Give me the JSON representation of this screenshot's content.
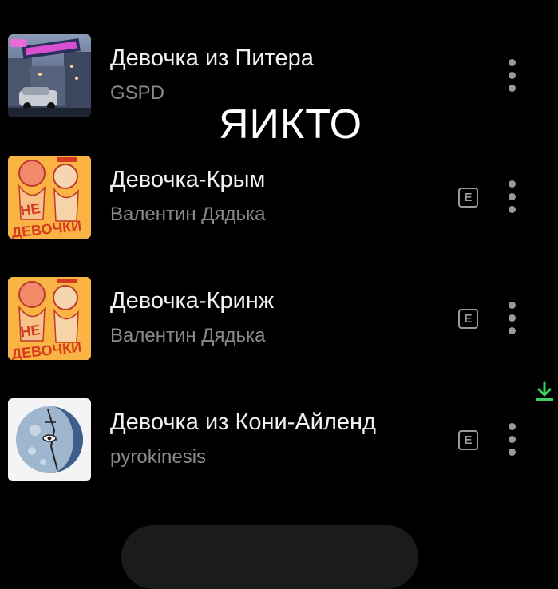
{
  "overlay": {
    "text": "ЯИКТО"
  },
  "tracks": [
    {
      "title": "Девочка из Питера",
      "artist": "GSPD",
      "explicit": false,
      "cover": "city-night-cover"
    },
    {
      "title": "Девочка-Крым",
      "artist": "Валентин Дядька",
      "explicit": true,
      "explicit_label": "E",
      "cover": "orange-girls-cover"
    },
    {
      "title": "Девочка-Кринж",
      "artist": "Валентин Дядька",
      "explicit": true,
      "explicit_label": "E",
      "cover": "orange-girls-cover"
    },
    {
      "title": "Девочка из Кони-Айленд",
      "artist": "pyrokinesis",
      "explicit": true,
      "explicit_label": "E",
      "cover": "moon-sketch-cover",
      "downloaded": true
    }
  ],
  "colors": {
    "background": "#000000",
    "title": "#f2f2f2",
    "subtitle": "#8a8a8a",
    "icon": "#9a9a9a",
    "download": "#3fcf5a"
  },
  "icons": {
    "more": "more-vertical-icon",
    "explicit": "explicit-icon",
    "download": "download-icon"
  }
}
